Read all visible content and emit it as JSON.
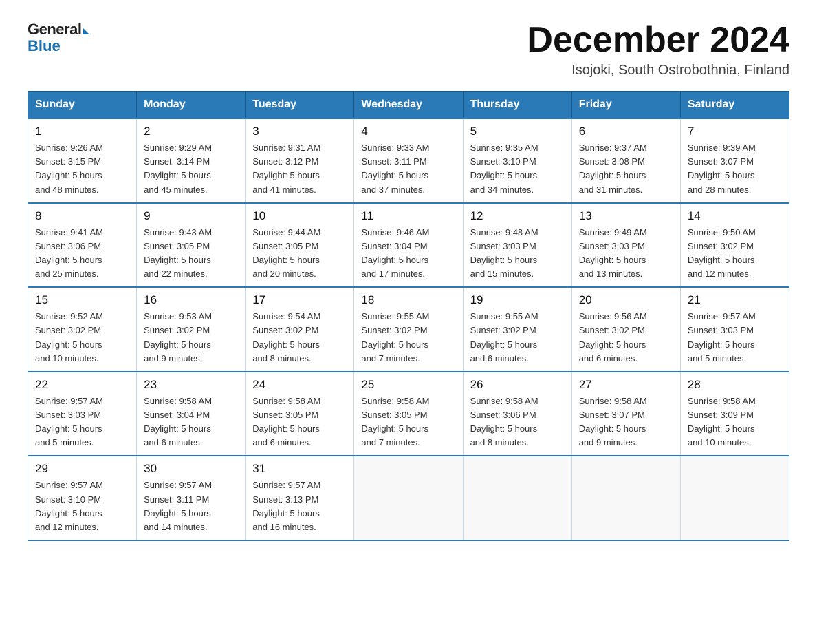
{
  "header": {
    "logo_general": "General",
    "logo_blue": "Blue",
    "month_title": "December 2024",
    "subtitle": "Isojoki, South Ostrobothnia, Finland"
  },
  "weekdays": [
    "Sunday",
    "Monday",
    "Tuesday",
    "Wednesday",
    "Thursday",
    "Friday",
    "Saturday"
  ],
  "weeks": [
    [
      {
        "day": "1",
        "info": "Sunrise: 9:26 AM\nSunset: 3:15 PM\nDaylight: 5 hours\nand 48 minutes."
      },
      {
        "day": "2",
        "info": "Sunrise: 9:29 AM\nSunset: 3:14 PM\nDaylight: 5 hours\nand 45 minutes."
      },
      {
        "day": "3",
        "info": "Sunrise: 9:31 AM\nSunset: 3:12 PM\nDaylight: 5 hours\nand 41 minutes."
      },
      {
        "day": "4",
        "info": "Sunrise: 9:33 AM\nSunset: 3:11 PM\nDaylight: 5 hours\nand 37 minutes."
      },
      {
        "day": "5",
        "info": "Sunrise: 9:35 AM\nSunset: 3:10 PM\nDaylight: 5 hours\nand 34 minutes."
      },
      {
        "day": "6",
        "info": "Sunrise: 9:37 AM\nSunset: 3:08 PM\nDaylight: 5 hours\nand 31 minutes."
      },
      {
        "day": "7",
        "info": "Sunrise: 9:39 AM\nSunset: 3:07 PM\nDaylight: 5 hours\nand 28 minutes."
      }
    ],
    [
      {
        "day": "8",
        "info": "Sunrise: 9:41 AM\nSunset: 3:06 PM\nDaylight: 5 hours\nand 25 minutes."
      },
      {
        "day": "9",
        "info": "Sunrise: 9:43 AM\nSunset: 3:05 PM\nDaylight: 5 hours\nand 22 minutes."
      },
      {
        "day": "10",
        "info": "Sunrise: 9:44 AM\nSunset: 3:05 PM\nDaylight: 5 hours\nand 20 minutes."
      },
      {
        "day": "11",
        "info": "Sunrise: 9:46 AM\nSunset: 3:04 PM\nDaylight: 5 hours\nand 17 minutes."
      },
      {
        "day": "12",
        "info": "Sunrise: 9:48 AM\nSunset: 3:03 PM\nDaylight: 5 hours\nand 15 minutes."
      },
      {
        "day": "13",
        "info": "Sunrise: 9:49 AM\nSunset: 3:03 PM\nDaylight: 5 hours\nand 13 minutes."
      },
      {
        "day": "14",
        "info": "Sunrise: 9:50 AM\nSunset: 3:02 PM\nDaylight: 5 hours\nand 12 minutes."
      }
    ],
    [
      {
        "day": "15",
        "info": "Sunrise: 9:52 AM\nSunset: 3:02 PM\nDaylight: 5 hours\nand 10 minutes."
      },
      {
        "day": "16",
        "info": "Sunrise: 9:53 AM\nSunset: 3:02 PM\nDaylight: 5 hours\nand 9 minutes."
      },
      {
        "day": "17",
        "info": "Sunrise: 9:54 AM\nSunset: 3:02 PM\nDaylight: 5 hours\nand 8 minutes."
      },
      {
        "day": "18",
        "info": "Sunrise: 9:55 AM\nSunset: 3:02 PM\nDaylight: 5 hours\nand 7 minutes."
      },
      {
        "day": "19",
        "info": "Sunrise: 9:55 AM\nSunset: 3:02 PM\nDaylight: 5 hours\nand 6 minutes."
      },
      {
        "day": "20",
        "info": "Sunrise: 9:56 AM\nSunset: 3:02 PM\nDaylight: 5 hours\nand 6 minutes."
      },
      {
        "day": "21",
        "info": "Sunrise: 9:57 AM\nSunset: 3:03 PM\nDaylight: 5 hours\nand 5 minutes."
      }
    ],
    [
      {
        "day": "22",
        "info": "Sunrise: 9:57 AM\nSunset: 3:03 PM\nDaylight: 5 hours\nand 5 minutes."
      },
      {
        "day": "23",
        "info": "Sunrise: 9:58 AM\nSunset: 3:04 PM\nDaylight: 5 hours\nand 6 minutes."
      },
      {
        "day": "24",
        "info": "Sunrise: 9:58 AM\nSunset: 3:05 PM\nDaylight: 5 hours\nand 6 minutes."
      },
      {
        "day": "25",
        "info": "Sunrise: 9:58 AM\nSunset: 3:05 PM\nDaylight: 5 hours\nand 7 minutes."
      },
      {
        "day": "26",
        "info": "Sunrise: 9:58 AM\nSunset: 3:06 PM\nDaylight: 5 hours\nand 8 minutes."
      },
      {
        "day": "27",
        "info": "Sunrise: 9:58 AM\nSunset: 3:07 PM\nDaylight: 5 hours\nand 9 minutes."
      },
      {
        "day": "28",
        "info": "Sunrise: 9:58 AM\nSunset: 3:09 PM\nDaylight: 5 hours\nand 10 minutes."
      }
    ],
    [
      {
        "day": "29",
        "info": "Sunrise: 9:57 AM\nSunset: 3:10 PM\nDaylight: 5 hours\nand 12 minutes."
      },
      {
        "day": "30",
        "info": "Sunrise: 9:57 AM\nSunset: 3:11 PM\nDaylight: 5 hours\nand 14 minutes."
      },
      {
        "day": "31",
        "info": "Sunrise: 9:57 AM\nSunset: 3:13 PM\nDaylight: 5 hours\nand 16 minutes."
      },
      {
        "day": "",
        "info": ""
      },
      {
        "day": "",
        "info": ""
      },
      {
        "day": "",
        "info": ""
      },
      {
        "day": "",
        "info": ""
      }
    ]
  ]
}
